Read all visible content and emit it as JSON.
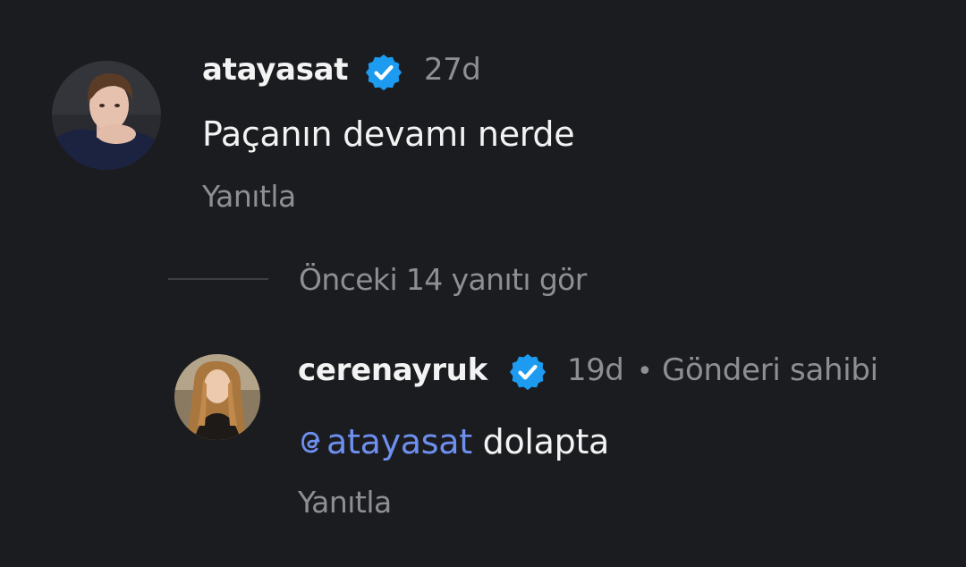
{
  "comments": [
    {
      "username": "atayasat",
      "verified": true,
      "timestamp": "27d",
      "text": "Paçanın devamı nerde",
      "reply_label": "Yanıtla",
      "avatar_icon": "person-avatar"
    }
  ],
  "thread": {
    "view_previous_label": "Önceki 14 yanıtı gör"
  },
  "replies": [
    {
      "username": "cerenayruk",
      "verified": true,
      "timestamp": "19d",
      "separator": "•",
      "author_tag": "Gönderi sahibi",
      "mention": "atayasat",
      "text": " dolapta",
      "reply_label": "Yanıtla",
      "avatar_icon": "person-avatar"
    }
  ],
  "colors": {
    "background": "#1b1c1f",
    "verified_badge": "#1d9bf0",
    "mention": "#6e8ff0",
    "muted": "#8d8f94"
  },
  "icons": [
    "verified-badge-icon",
    "threads-mention-icon"
  ]
}
